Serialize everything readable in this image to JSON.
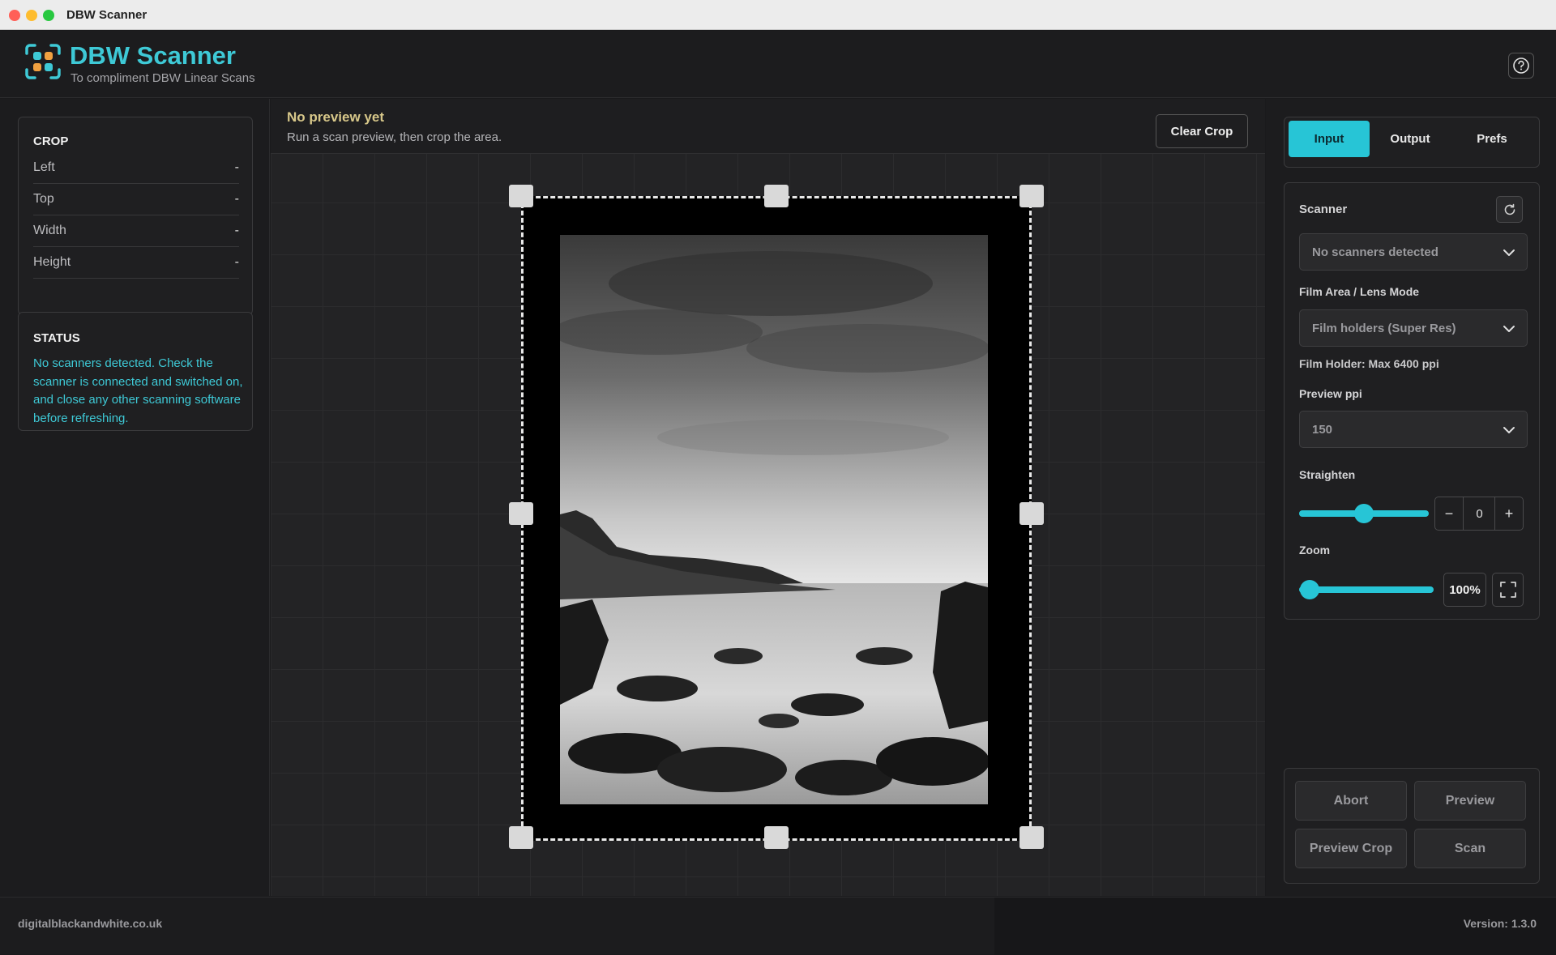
{
  "window": {
    "title": "DBW Scanner"
  },
  "header": {
    "app_name": "DBW Scanner",
    "subtitle": "To compliment DBW Linear Scans",
    "help_icon": "question-circle-icon"
  },
  "crop": {
    "title": "CROP",
    "rows": [
      {
        "label": "Left",
        "value": "-"
      },
      {
        "label": "Top",
        "value": "-"
      },
      {
        "label": "Width",
        "value": "-"
      },
      {
        "label": "Height",
        "value": "-"
      }
    ]
  },
  "status": {
    "title": "STATUS",
    "message": "No scanners detected. Check the scanner is connected and switched on, and close any other scanning software before refreshing."
  },
  "preview": {
    "title": "No preview yet",
    "subtitle": "Run a scan preview, then crop the area.",
    "clear_crop_label": "Clear Crop"
  },
  "tabs": [
    {
      "label": "Input",
      "active": true
    },
    {
      "label": "Output",
      "active": false
    },
    {
      "label": "Prefs",
      "active": false
    }
  ],
  "settings": {
    "scanner_label": "Scanner",
    "scanner_value": "No scanners detected",
    "film_area_label": "Film Area / Lens Mode",
    "film_area_value": "Film holders (Super Res)",
    "film_holder_info": "Film Holder: Max 6400 ppi",
    "preview_ppi_label": "Preview ppi",
    "preview_ppi_value": "150",
    "straighten_label": "Straighten",
    "straighten_value": "0",
    "straighten_minus": "−",
    "straighten_plus": "+",
    "zoom_label": "Zoom",
    "zoom_value": "100%"
  },
  "actions": {
    "abort": "Abort",
    "preview": "Preview",
    "preview_crop": "Preview Crop",
    "scan": "Scan"
  },
  "footer": {
    "site": "digitalblackandwhite.co.uk",
    "version": "Version: 1.3.0"
  },
  "colors": {
    "accent": "#27c5d6",
    "background": "#1c1c1e",
    "preview_title": "#d8c88a"
  }
}
